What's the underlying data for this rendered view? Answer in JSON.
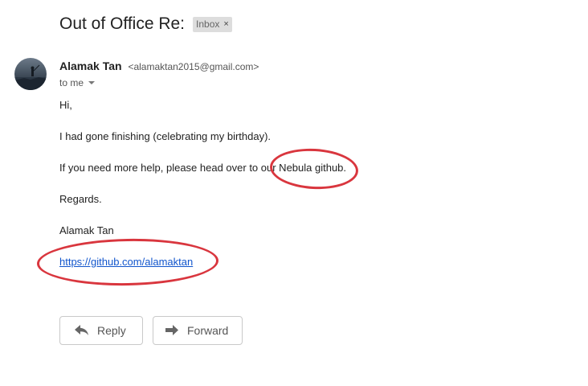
{
  "header": {
    "subject": "Out of Office Re:",
    "label": "Inbox",
    "label_remove_glyph": "×"
  },
  "message": {
    "sender_name": "Alamak Tan",
    "sender_email": "<alamaktan2015@gmail.com>",
    "to": "to me",
    "greeting": "Hi,",
    "line1": "I had gone finishing (celebrating my birthday).",
    "line2": "If you need more help, please head over to our Nebula github.",
    "regards": "Regards.",
    "signature": "Alamak Tan",
    "link": "https://github.com/alamaktan"
  },
  "actions": {
    "reply_label": "Reply",
    "forward_label": "Forward"
  },
  "colors": {
    "annotation": "#d9363e",
    "link": "#1155cc"
  },
  "icons": {
    "avatar": "avatar-photo",
    "reply": "reply-icon",
    "forward": "forward-icon"
  }
}
